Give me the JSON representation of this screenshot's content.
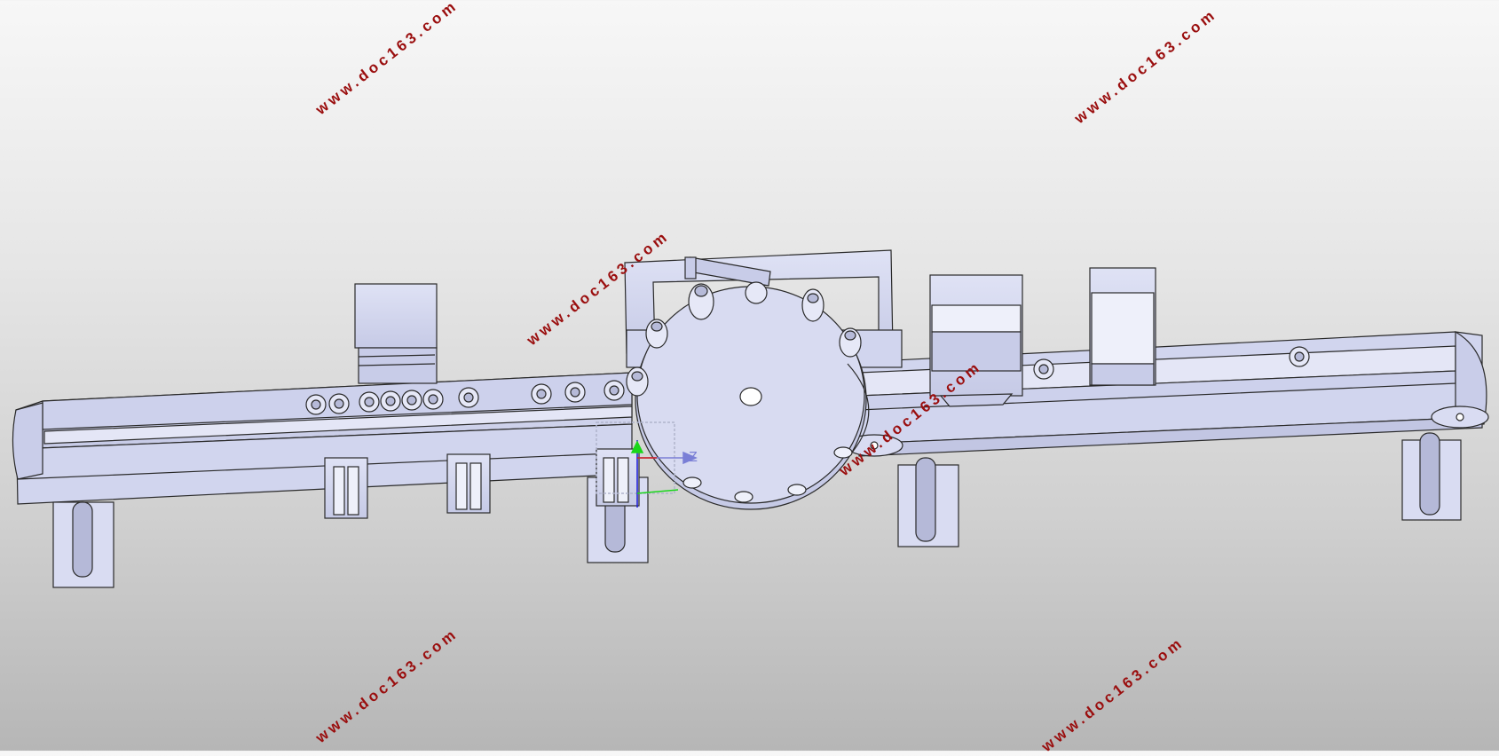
{
  "watermarks": [
    "www.doc163.com",
    "www.doc163.com",
    "www.doc163.com",
    "www.doc163.com",
    "www.doc163.com",
    "www.doc163.com"
  ],
  "triad": {
    "axis_label": "Z"
  },
  "colors": {
    "part_fill": "#d6d9f0",
    "part_shade": "#b9bddb",
    "edge": "#2a2a2a",
    "watermark": "#9a0e0e"
  },
  "scene": {
    "parts": [
      "left-conveyor",
      "turntable",
      "right-conveyor",
      "bottle-guide-bracket",
      "hoppers",
      "support-legs",
      "bottles"
    ]
  }
}
